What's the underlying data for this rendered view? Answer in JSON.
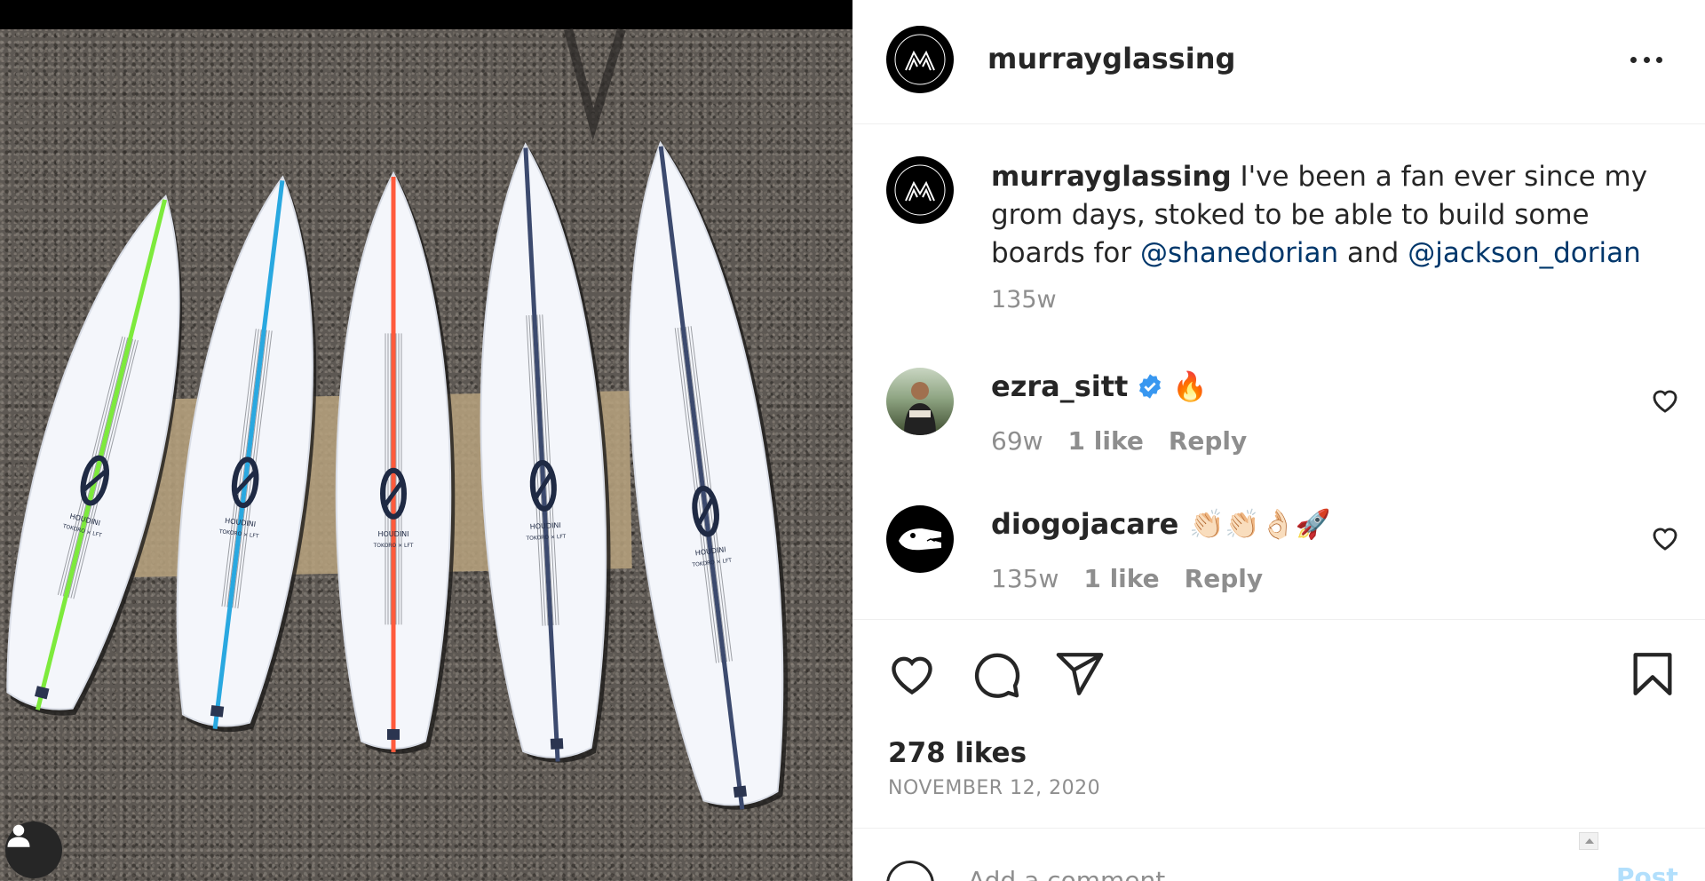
{
  "post": {
    "author": "murrayglassing",
    "avatar_label": "MURRAY GLASSING",
    "more_icon": "more-horizontal-icon",
    "caption": {
      "username": "murrayglassing",
      "text_1": " I've been a fan ever since my grom days, stoked to be able to build some boards for ",
      "mention_1": "@shanedorian",
      "text_2": " and ",
      "mention_2": "@jackson_dorian",
      "time": "135w"
    },
    "image": {
      "board_labels": [
        "HOUDINI",
        "HOUDINI",
        "HOUDINI",
        "HOUDINI",
        "HOUDINI"
      ],
      "board_sublabel": "TOKORO × LFT",
      "stringer_colors": [
        "#7dea3c",
        "#29a8e0",
        "#ff5a3c",
        "#3c4a6e",
        "#3c4a6e"
      ]
    }
  },
  "comments": [
    {
      "username": "ezra_sitt",
      "verified": true,
      "text": "🔥",
      "time": "69w",
      "likes": "1 like",
      "reply": "Reply"
    },
    {
      "username": "diogojacare",
      "verified": false,
      "text": "👏🏻👏🏻👌🏻🚀",
      "time": "135w",
      "likes": "1 like",
      "reply": "Reply"
    }
  ],
  "actions": {
    "like_icon": "heart-icon",
    "comment_icon": "comment-icon",
    "share_icon": "paper-plane-icon",
    "save_icon": "bookmark-icon"
  },
  "likes": "278 likes",
  "date": "NOVEMBER 12, 2020",
  "comment_form": {
    "placeholder": "Add a comment...",
    "post_label": "Post"
  },
  "colors": {
    "link": "#00376b",
    "muted": "#8e8e8e",
    "text": "#262626",
    "post_disabled": "#b2dffc",
    "verified": "#3897f0"
  }
}
